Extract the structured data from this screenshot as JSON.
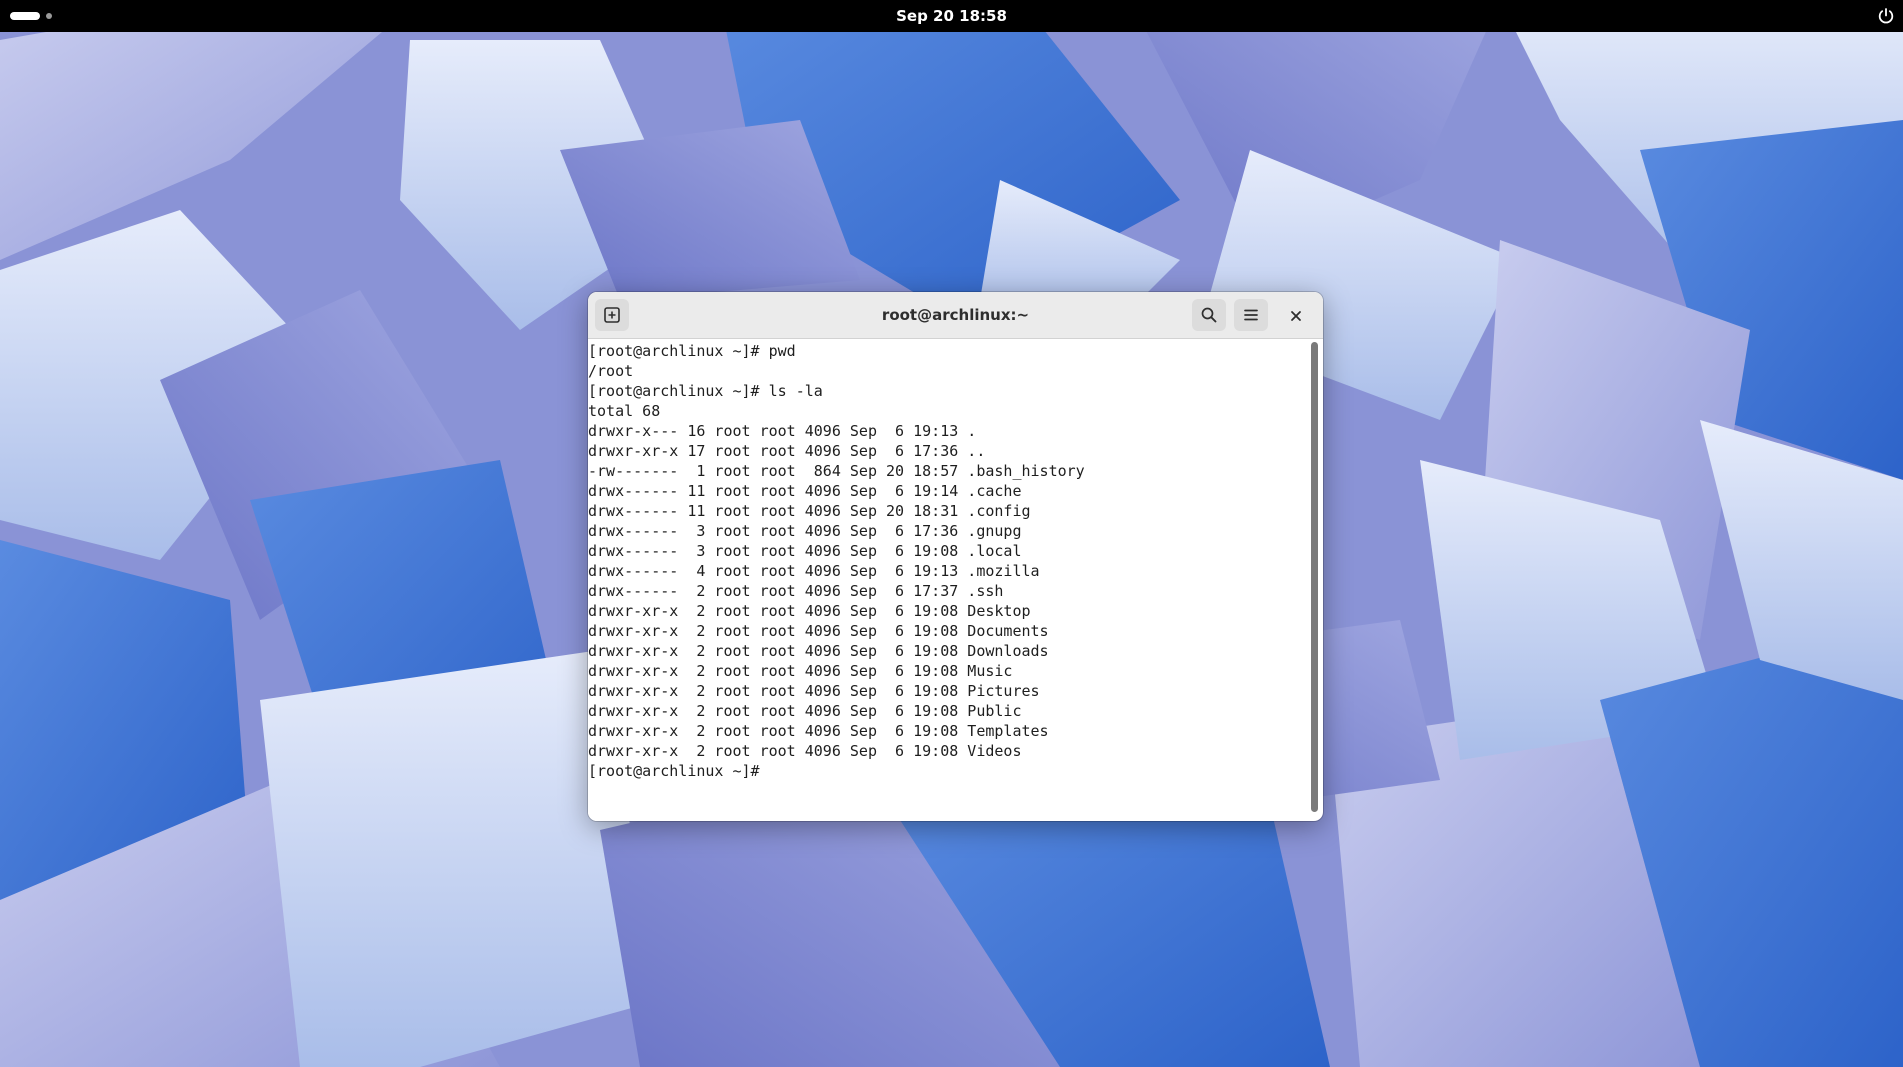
{
  "topbar": {
    "datetime": "Sep 20  18:58",
    "icons": {
      "activities": "workspace-indicator-icon",
      "power": "power-icon"
    }
  },
  "window": {
    "title": "root@archlinux:~",
    "icons": {
      "new_tab": "new-tab-icon",
      "search": "search-icon",
      "menu": "hamburger-menu-icon",
      "close": "close-icon"
    }
  },
  "terminal": {
    "lines": [
      "[root@archlinux ~]# pwd",
      "/root",
      "[root@archlinux ~]# ls -la",
      "total 68",
      "drwxr-x--- 16 root root 4096 Sep  6 19:13 .",
      "drwxr-xr-x 17 root root 4096 Sep  6 17:36 ..",
      "-rw-------  1 root root  864 Sep 20 18:57 .bash_history",
      "drwx------ 11 root root 4096 Sep  6 19:14 .cache",
      "drwx------ 11 root root 4096 Sep 20 18:31 .config",
      "drwx------  3 root root 4096 Sep  6 17:36 .gnupg",
      "drwx------  3 root root 4096 Sep  6 19:08 .local",
      "drwx------  4 root root 4096 Sep  6 19:13 .mozilla",
      "drwx------  2 root root 4096 Sep  6 17:37 .ssh",
      "drwxr-xr-x  2 root root 4096 Sep  6 19:08 Desktop",
      "drwxr-xr-x  2 root root 4096 Sep  6 19:08 Documents",
      "drwxr-xr-x  2 root root 4096 Sep  6 19:08 Downloads",
      "drwxr-xr-x  2 root root 4096 Sep  6 19:08 Music",
      "drwxr-xr-x  2 root root 4096 Sep  6 19:08 Pictures",
      "drwxr-xr-x  2 root root 4096 Sep  6 19:08 Public",
      "drwxr-xr-x  2 root root 4096 Sep  6 19:08 Templates",
      "drwxr-xr-x  2 root root 4096 Sep  6 19:08 Videos",
      "[root@archlinux ~]# "
    ]
  },
  "colors": {
    "topbar_bg": "#000000",
    "headerbar_bg": "#ebebeb",
    "terminal_bg": "#ffffff",
    "terminal_fg": "#1e1e1e",
    "wallpaper_primary": "#3f76d3",
    "wallpaper_secondary": "#8ea1df"
  }
}
